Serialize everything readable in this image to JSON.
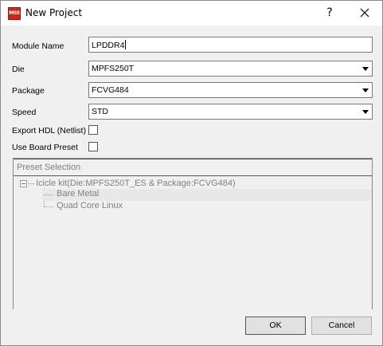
{
  "window": {
    "title": "New Project",
    "app_icon_text": "MSS",
    "help_label": "?"
  },
  "form": {
    "module_name": {
      "label": "Module Name",
      "value": "LPDDR4"
    },
    "die": {
      "label": "Die",
      "value": "MPFS250T"
    },
    "package": {
      "label": "Package",
      "value": "FCVG484"
    },
    "speed": {
      "label": "Speed",
      "value": "STD"
    },
    "export_hdl": {
      "label": "Export HDL (Netlist)",
      "checked": false
    },
    "use_board_preset": {
      "label": "Use Board Preset",
      "checked": false
    }
  },
  "preset": {
    "header": "Preset Selection",
    "root": "Icicle kit(Die:MPFS250T_ES & Package:FCVG484)",
    "items": [
      "Bare Metal",
      "Quad Core Linux"
    ]
  },
  "buttons": {
    "ok": "OK",
    "cancel": "Cancel"
  }
}
